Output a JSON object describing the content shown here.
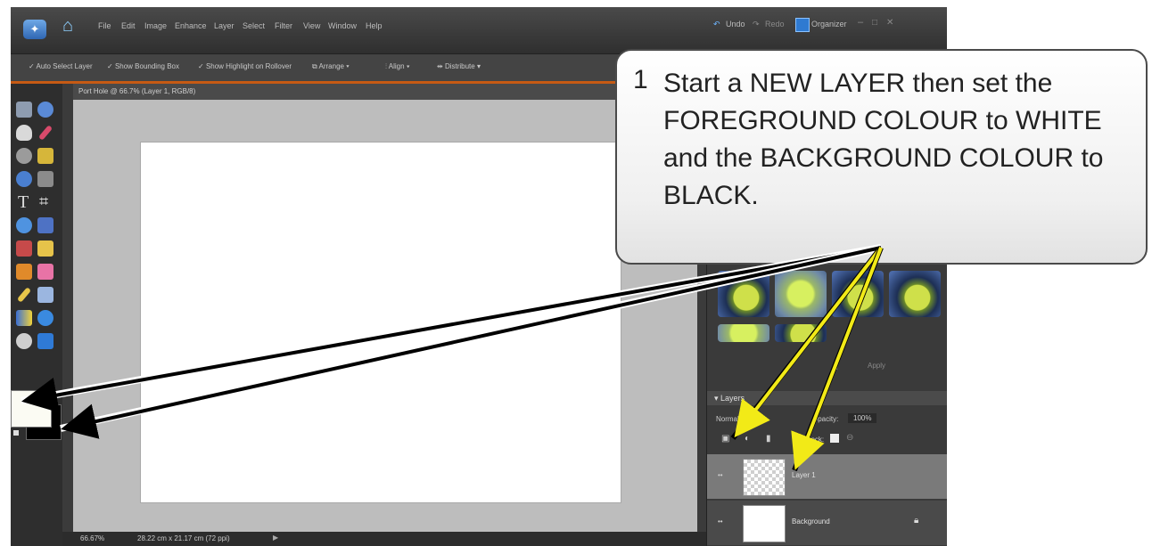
{
  "menubar": {
    "items": [
      "File",
      "Edit",
      "Image",
      "Enhance",
      "Layer",
      "Select",
      "Filter",
      "View",
      "Window",
      "Help"
    ],
    "undo": "Undo",
    "redo": "Redo",
    "organizer": "Organizer"
  },
  "options": {
    "auto_select": "Auto Select Layer",
    "bounding_box": "Show Bounding Box",
    "highlight": "Show Highlight on Rollover",
    "arrange": "Arrange",
    "align": "Align",
    "distribute": "Distribute"
  },
  "document": {
    "tab_title": "Port Hole @ 66.7% (Layer 1, RGB/8)",
    "zoom": "66.67%",
    "size": "28.22 cm x 21.17 cm (72 ppi)"
  },
  "panel": {
    "apply": "Apply",
    "layers_header": "Layers",
    "blend_mode": "Normal",
    "opacity_label": "Opacity:",
    "opacity_value": "100%",
    "lock_label": "Lock:",
    "layers": [
      "Layer 1",
      "Background"
    ]
  },
  "callout": {
    "number": "1",
    "text": "Start a NEW LAYER then set the FOREGROUND COLOUR to WHITE and the BACKGROUND COLOUR to BLACK."
  },
  "colors": {
    "foreground": "#fbfbf3",
    "background": "#000000",
    "accent_orange": "#c65a14",
    "arrow_yellow": "#f2ea17"
  }
}
